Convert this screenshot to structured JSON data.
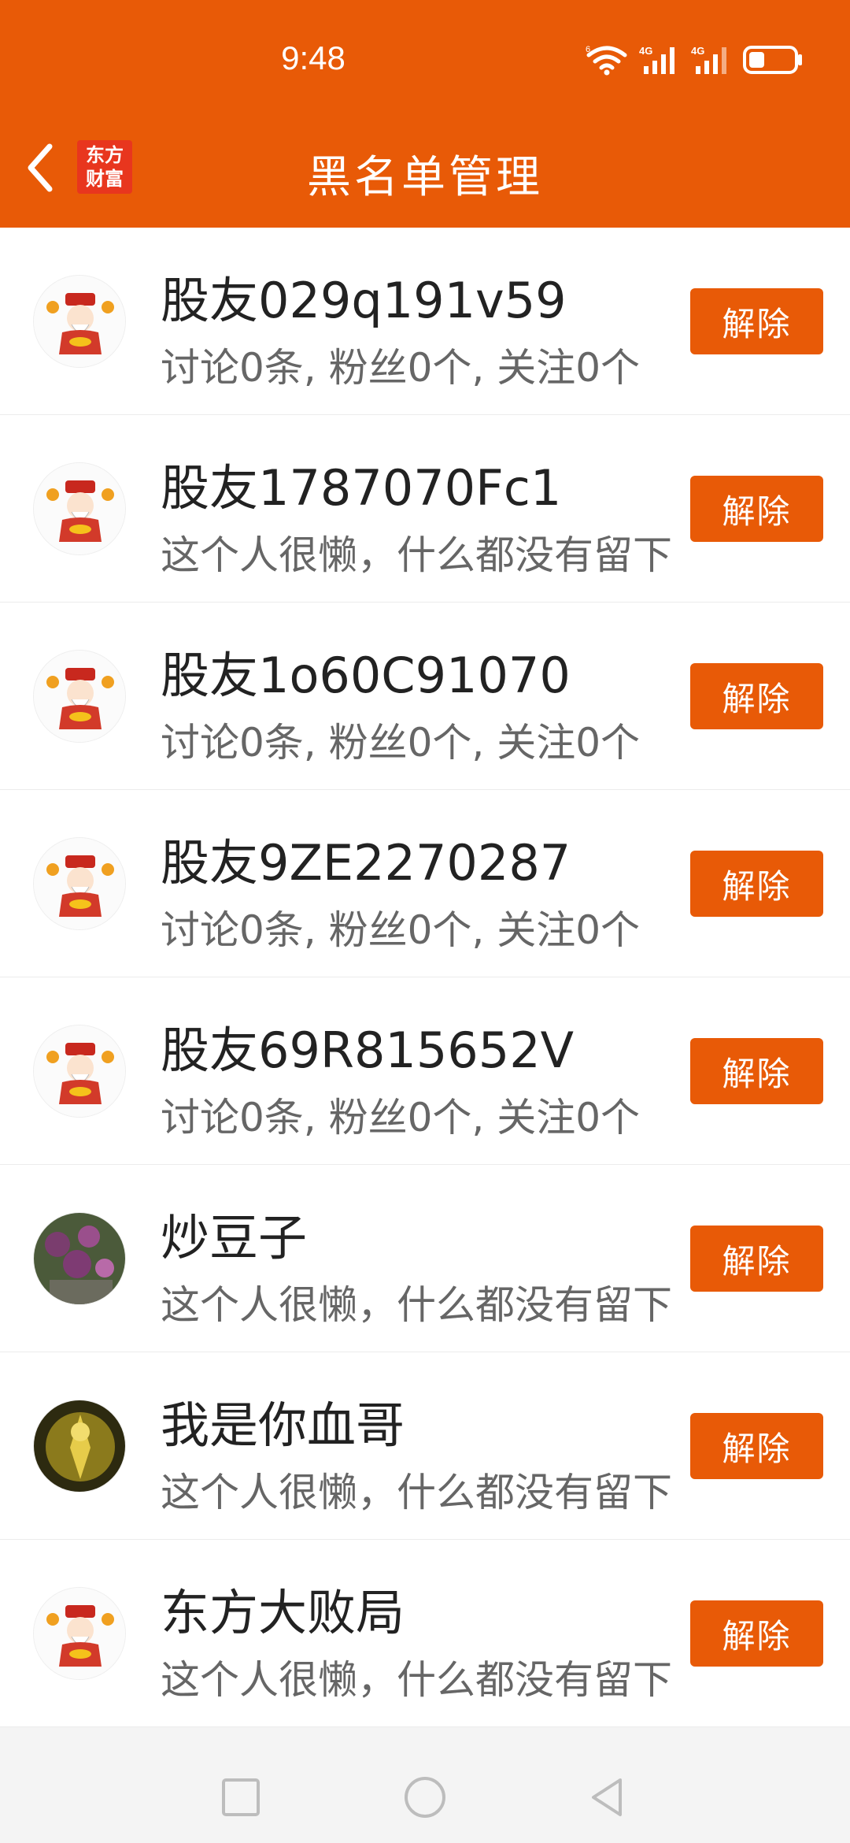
{
  "status_bar": {
    "time": "9:48",
    "wifi_badge": "6",
    "signal1_label": "4G",
    "signal2_label": "4G",
    "icons": [
      "wifi-icon",
      "signal-icon",
      "signal-icon",
      "battery-icon"
    ],
    "battery_level": 0.35
  },
  "header": {
    "back_icon": "chevron-left-icon",
    "logo_line1": "东方",
    "logo_line2": "财富",
    "title": "黑名单管理",
    "background": "#e85a07"
  },
  "blacklist": [
    {
      "name": "股友029q191v59",
      "description": "讨论0条, 粉丝0个, 关注0个",
      "avatar": "god-of-wealth-avatar",
      "action": "解除"
    },
    {
      "name": "股友1787070Fc1",
      "description": "这个人很懒，什么都没有留下",
      "avatar": "god-of-wealth-avatar",
      "action": "解除"
    },
    {
      "name": "股友1o60C91070",
      "description": "讨论0条, 粉丝0个, 关注0个",
      "avatar": "god-of-wealth-avatar",
      "action": "解除"
    },
    {
      "name": "股友9ZE2270287",
      "description": "讨论0条, 粉丝0个, 关注0个",
      "avatar": "god-of-wealth-avatar",
      "action": "解除"
    },
    {
      "name": "股友69R815652V",
      "description": "讨论0条, 粉丝0个, 关注0个",
      "avatar": "god-of-wealth-avatar",
      "action": "解除"
    },
    {
      "name": "炒豆子",
      "description": "这个人很懒，什么都没有留下",
      "avatar": "flower-photo-avatar",
      "action": "解除"
    },
    {
      "name": "我是你血哥",
      "description": "这个人很懒，什么都没有留下",
      "avatar": "golden-figure-avatar",
      "action": "解除"
    },
    {
      "name": "东方大败局",
      "description": "这个人很懒，什么都没有留下",
      "avatar": "god-of-wealth-avatar",
      "action": "解除"
    }
  ],
  "nav_bar": {
    "buttons": [
      "recents-square-icon",
      "home-circle-icon",
      "back-triangle-icon"
    ]
  },
  "colors": {
    "accent": "#e85a07",
    "text_primary": "#222222",
    "text_secondary": "#666666"
  }
}
